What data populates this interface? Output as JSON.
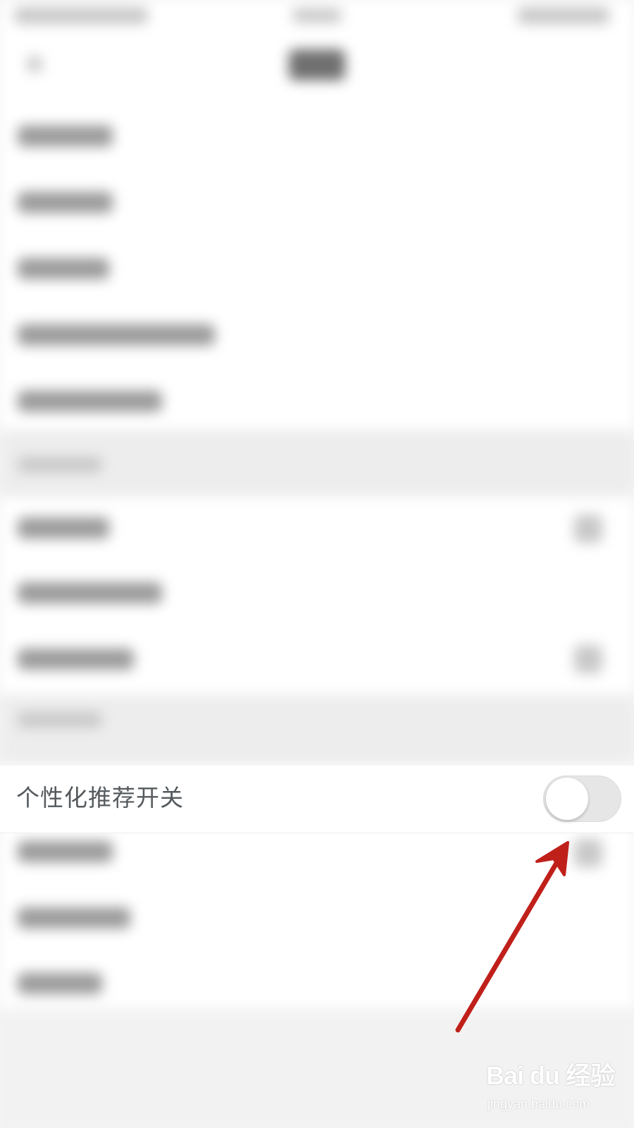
{
  "setting_row": {
    "label": "个性化推荐开关",
    "toggle_on": false
  },
  "watermark": {
    "brand": "Bai du 经验",
    "url": "jingyan.baidu.com"
  },
  "colors": {
    "annotation_arrow": "#c0201a",
    "toggle_track": "#e6e6e6",
    "toggle_knob": "#ffffff",
    "label_text": "#555a5e"
  }
}
